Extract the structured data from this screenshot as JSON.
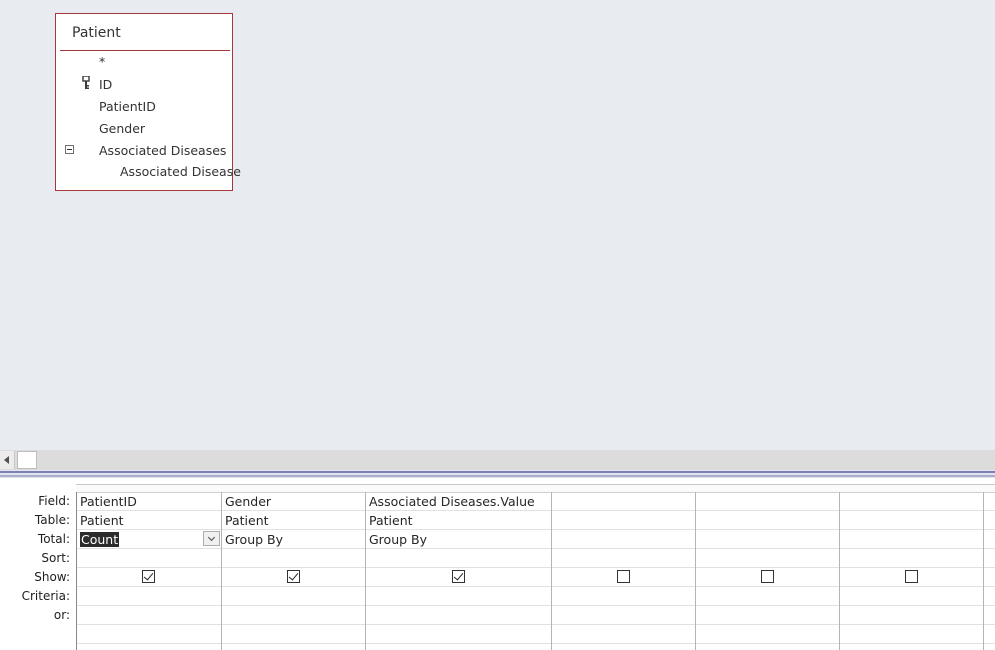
{
  "table_box": {
    "title": "Patient",
    "fields": [
      "*",
      "ID",
      "PatientID",
      "Gender",
      "Associated Diseases",
      "Associated Disease"
    ],
    "primary_key_field": "ID",
    "expanded_field": "Associated Diseases"
  },
  "grid": {
    "row_labels": [
      "Field:",
      "Table:",
      "Total:",
      "Sort:",
      "Show:",
      "Criteria:",
      "or:"
    ],
    "columns": [
      {
        "field": "PatientID",
        "table": "Patient",
        "total": "Count",
        "sort": "",
        "show": true,
        "criteria": "",
        "or": ""
      },
      {
        "field": "Gender",
        "table": "Patient",
        "total": "Group By",
        "sort": "",
        "show": true,
        "criteria": "",
        "or": ""
      },
      {
        "field": "Associated Diseases.Value",
        "table": "Patient",
        "total": "Group By",
        "sort": "",
        "show": true,
        "criteria": "",
        "or": ""
      },
      {
        "field": "",
        "table": "",
        "total": "",
        "sort": "",
        "show": false,
        "criteria": "",
        "or": ""
      },
      {
        "field": "",
        "table": "",
        "total": "",
        "sort": "",
        "show": false,
        "criteria": "",
        "or": ""
      },
      {
        "field": "",
        "table": "",
        "total": "",
        "sort": "",
        "show": false,
        "criteria": "",
        "or": ""
      }
    ],
    "active_cell": "Total: PatientID (dropdown open)"
  },
  "icons": {
    "key": "primary-key-icon",
    "collapse": "collapse-minus-icon",
    "dropdown": "chevron-down-icon",
    "scroll_left": "scroll-left-arrow-icon"
  },
  "colors": {
    "table_border": "#a4373a",
    "design_background": "#e8ebef",
    "splitter": "#7b83b4"
  }
}
